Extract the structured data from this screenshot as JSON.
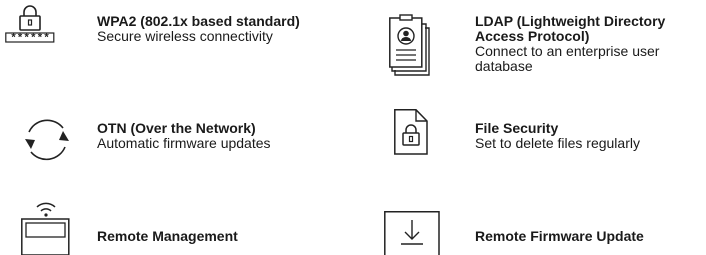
{
  "features": {
    "wpa2": {
      "title": "WPA2 (802.1x based standard)",
      "desc": "Secure wireless connectivity",
      "icon": "wireless-lock-password-icon",
      "password_mask": "******"
    },
    "ldap": {
      "title": "LDAP (Lightweight Directory Access Protocol)",
      "desc": "Connect to an enterprise user database",
      "icon": "user-directory-icon"
    },
    "otn": {
      "title": "OTN (Over the Network)",
      "desc": "Automatic firmware updates",
      "icon": "refresh-cycle-icon"
    },
    "file_security": {
      "title": "File Security",
      "desc": "Set to delete files regularly",
      "icon": "locked-file-icon"
    },
    "remote_management": {
      "title": "Remote Management",
      "icon": "remote-device-icon"
    },
    "remote_firmware_update": {
      "title": "Remote Firmware Update",
      "icon": "download-box-icon"
    }
  },
  "colors": {
    "text": "#1a1a1a",
    "icon_stroke": "#222222"
  }
}
